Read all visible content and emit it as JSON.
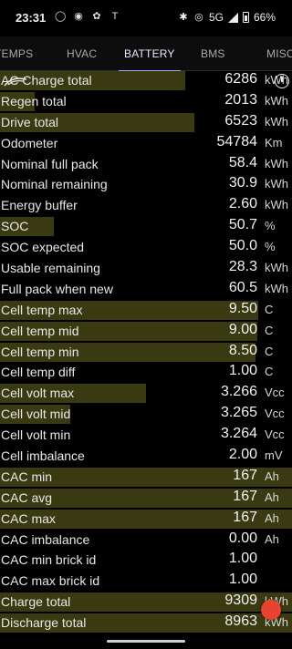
{
  "status_bar": {
    "time": "23:31",
    "network": "5G",
    "battery": "66%"
  },
  "tabs": [
    {
      "label": "TEMPS",
      "active": false
    },
    {
      "label": "HVAC",
      "active": false
    },
    {
      "label": "BATTERY",
      "active": true
    },
    {
      "label": "BMS",
      "active": false
    },
    {
      "label": "MISC",
      "active": false
    }
  ],
  "rows": [
    {
      "label": "AC Charge total",
      "value": "6286",
      "unit": "kWh",
      "bar": 0.635
    },
    {
      "label": "Regen total",
      "value": "2013",
      "unit": "kWh",
      "bar": 0.12
    },
    {
      "label": "Drive total",
      "value": "6523",
      "unit": "kWh",
      "bar": 0.665
    },
    {
      "label": "Odometer",
      "value": "54784",
      "unit": "Km",
      "bar": 0
    },
    {
      "label": "Nominal full pack",
      "value": "58.4",
      "unit": "kWh",
      "bar": 0
    },
    {
      "label": "Nominal remaining",
      "value": "30.9",
      "unit": "kWh",
      "bar": 0
    },
    {
      "label": "Energy buffer",
      "value": "2.60",
      "unit": "kWh",
      "bar": 0
    },
    {
      "label": "SOC",
      "value": "50.7",
      "unit": "%",
      "bar": 0.185
    },
    {
      "label": "SOC expected",
      "value": "50.0",
      "unit": "%",
      "bar": 0
    },
    {
      "label": "Usable remaining",
      "value": "28.3",
      "unit": "kWh",
      "bar": 0
    },
    {
      "label": "Full pack when new",
      "value": "60.5",
      "unit": "kWh",
      "bar": 0
    },
    {
      "label": "Cell temp max",
      "value": "9.50",
      "unit": "C",
      "bar": 0.885
    },
    {
      "label": "Cell temp mid",
      "value": "9.00",
      "unit": "C",
      "bar": 0.88
    },
    {
      "label": "Cell temp min",
      "value": "8.50",
      "unit": "C",
      "bar": 0.875
    },
    {
      "label": "Cell temp diff",
      "value": "1.00",
      "unit": "C",
      "bar": 0
    },
    {
      "label": "Cell volt max",
      "value": "3.266",
      "unit": "Vcc",
      "bar": 0.5
    },
    {
      "label": "Cell volt mid",
      "value": "3.265",
      "unit": "Vcc",
      "bar": 0.24
    },
    {
      "label": "Cell volt min",
      "value": "3.264",
      "unit": "Vcc",
      "bar": 0
    },
    {
      "label": "Cell imbalance",
      "value": "2.00",
      "unit": "mV",
      "bar": 0
    },
    {
      "label": "CAC min",
      "value": "167",
      "unit": "Ah",
      "bar": 1.0
    },
    {
      "label": "CAC avg",
      "value": "167",
      "unit": "Ah",
      "bar": 1.0
    },
    {
      "label": "CAC max",
      "value": "167",
      "unit": "Ah",
      "bar": 1.0
    },
    {
      "label": "CAC imbalance",
      "value": "0.00",
      "unit": "Ah",
      "bar": 0
    },
    {
      "label": "CAC min brick id",
      "value": "1.00",
      "unit": "",
      "bar": 0
    },
    {
      "label": "CAC max brick id",
      "value": "1.00",
      "unit": "",
      "bar": 0
    },
    {
      "label": "Charge total",
      "value": "9309",
      "unit": "kWh",
      "bar": 1.0
    },
    {
      "label": "Discharge total",
      "value": "8963",
      "unit": "kWh",
      "bar": 1.0
    }
  ],
  "colors": {
    "bar": "#3a3a12",
    "fab": "#e8432e",
    "tab_indicator": "#9aa6ff"
  }
}
